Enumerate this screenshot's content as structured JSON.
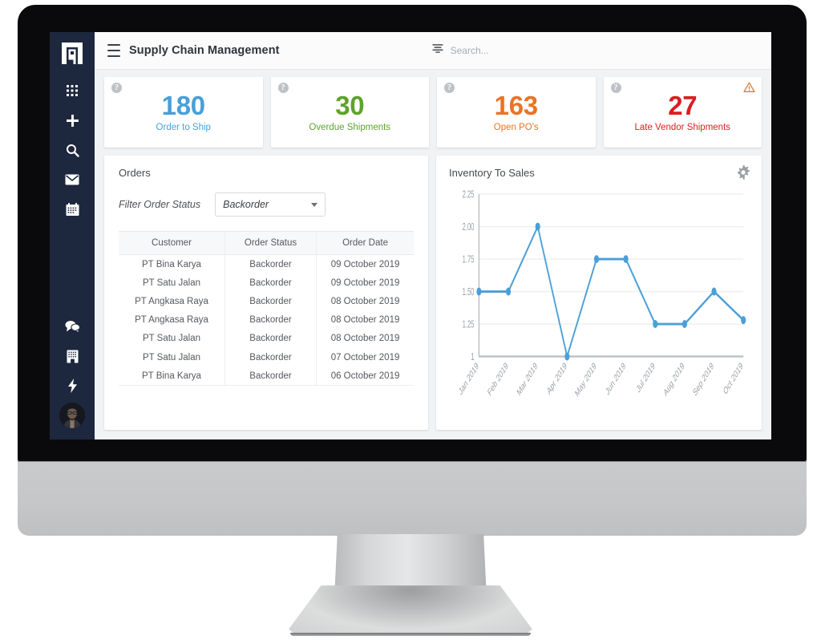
{
  "app": {
    "title": "Supply Chain Management",
    "hamburger_icon": "hamburger-menu-icon",
    "logo_icon": "app-logo-icon"
  },
  "search": {
    "icon": "filter-search-icon",
    "placeholder": "Search...",
    "value": ""
  },
  "sidebar": {
    "items": [
      {
        "name": "apps-grid",
        "icon": "apps-grid-icon"
      },
      {
        "name": "add",
        "icon": "plus-icon"
      },
      {
        "name": "search",
        "icon": "search-icon"
      },
      {
        "name": "mail",
        "icon": "envelope-icon"
      },
      {
        "name": "calendar",
        "icon": "calendar-icon"
      }
    ],
    "bottom_items": [
      {
        "name": "chat",
        "icon": "chat-bubbles-icon"
      },
      {
        "name": "company",
        "icon": "building-icon"
      },
      {
        "name": "activity",
        "icon": "lightning-bolt-icon"
      }
    ],
    "avatar": {
      "name": "user-avatar",
      "icon": "avatar-photo"
    },
    "background_color": "#1d283f"
  },
  "kpis": [
    {
      "value": "180",
      "label": "Order to Ship",
      "color": "#4a9fd8",
      "help_icon": "help-circle-icon",
      "help_glyph": "?",
      "warning": false
    },
    {
      "value": "30",
      "label": "Overdue Shipments",
      "color": "#5da329",
      "help_icon": "help-circle-icon",
      "help_glyph": "?",
      "warning": false
    },
    {
      "value": "163",
      "label": "Open PO's",
      "color": "#ea7324",
      "help_icon": "help-circle-icon",
      "help_glyph": "?",
      "warning": false
    },
    {
      "value": "27",
      "label": "Late Vendor Shipments",
      "color": "#d81f20",
      "help_icon": "help-circle-icon",
      "help_glyph": "?",
      "warning": true,
      "warning_icon": "warning-triangle-icon",
      "warning_color": "#d2743c"
    }
  ],
  "orders": {
    "title": "Orders",
    "filter_label": "Filter Order Status",
    "filter_selected": "Backorder",
    "filter_caret_icon": "chevron-down-icon",
    "columns": [
      "Customer",
      "Order Status",
      "Order Date"
    ],
    "rows": [
      [
        "PT Bina Karya",
        "Backorder",
        "09 October 2019"
      ],
      [
        "PT Satu Jalan",
        "Backorder",
        "09 October 2019"
      ],
      [
        "PT Angkasa Raya",
        "Backorder",
        "08 October 2019"
      ],
      [
        "PT Angkasa Raya",
        "Backorder",
        "08 October 2019"
      ],
      [
        "PT Satu Jalan",
        "Backorder",
        "08 October 2019"
      ],
      [
        "PT Satu Jalan",
        "Backorder",
        "07 October 2019"
      ],
      [
        "PT Bina Karya",
        "Backorder",
        "06 October 2019"
      ]
    ]
  },
  "inventory_panel": {
    "title": "Inventory To Sales",
    "settings_icon": "gear-icon"
  },
  "chart_data": {
    "type": "line",
    "title": "Inventory To Sales",
    "xlabel": "",
    "ylabel": "",
    "x": [
      "Jan 2019",
      "Feb 2019",
      "Mar 2019",
      "Apr 2019",
      "May 2019",
      "Jun 2019",
      "Jul 2019",
      "Aug 2019",
      "Sep 2019",
      "Oct 2019"
    ],
    "values": [
      1.5,
      1.5,
      2.0,
      1.0,
      1.75,
      1.75,
      1.25,
      1.25,
      1.5,
      1.28
    ],
    "ylim": [
      1.0,
      2.25
    ],
    "yticks": [
      "2.25",
      "2.00",
      "1.75",
      "1.50",
      "1.25",
      "1"
    ],
    "ytick_values": [
      2.25,
      2.0,
      1.75,
      1.5,
      1.25,
      1.0
    ],
    "grid": true,
    "legend": false,
    "series_color": "#4a9fd8",
    "marker": "circle",
    "xtick_rotation": -45
  }
}
